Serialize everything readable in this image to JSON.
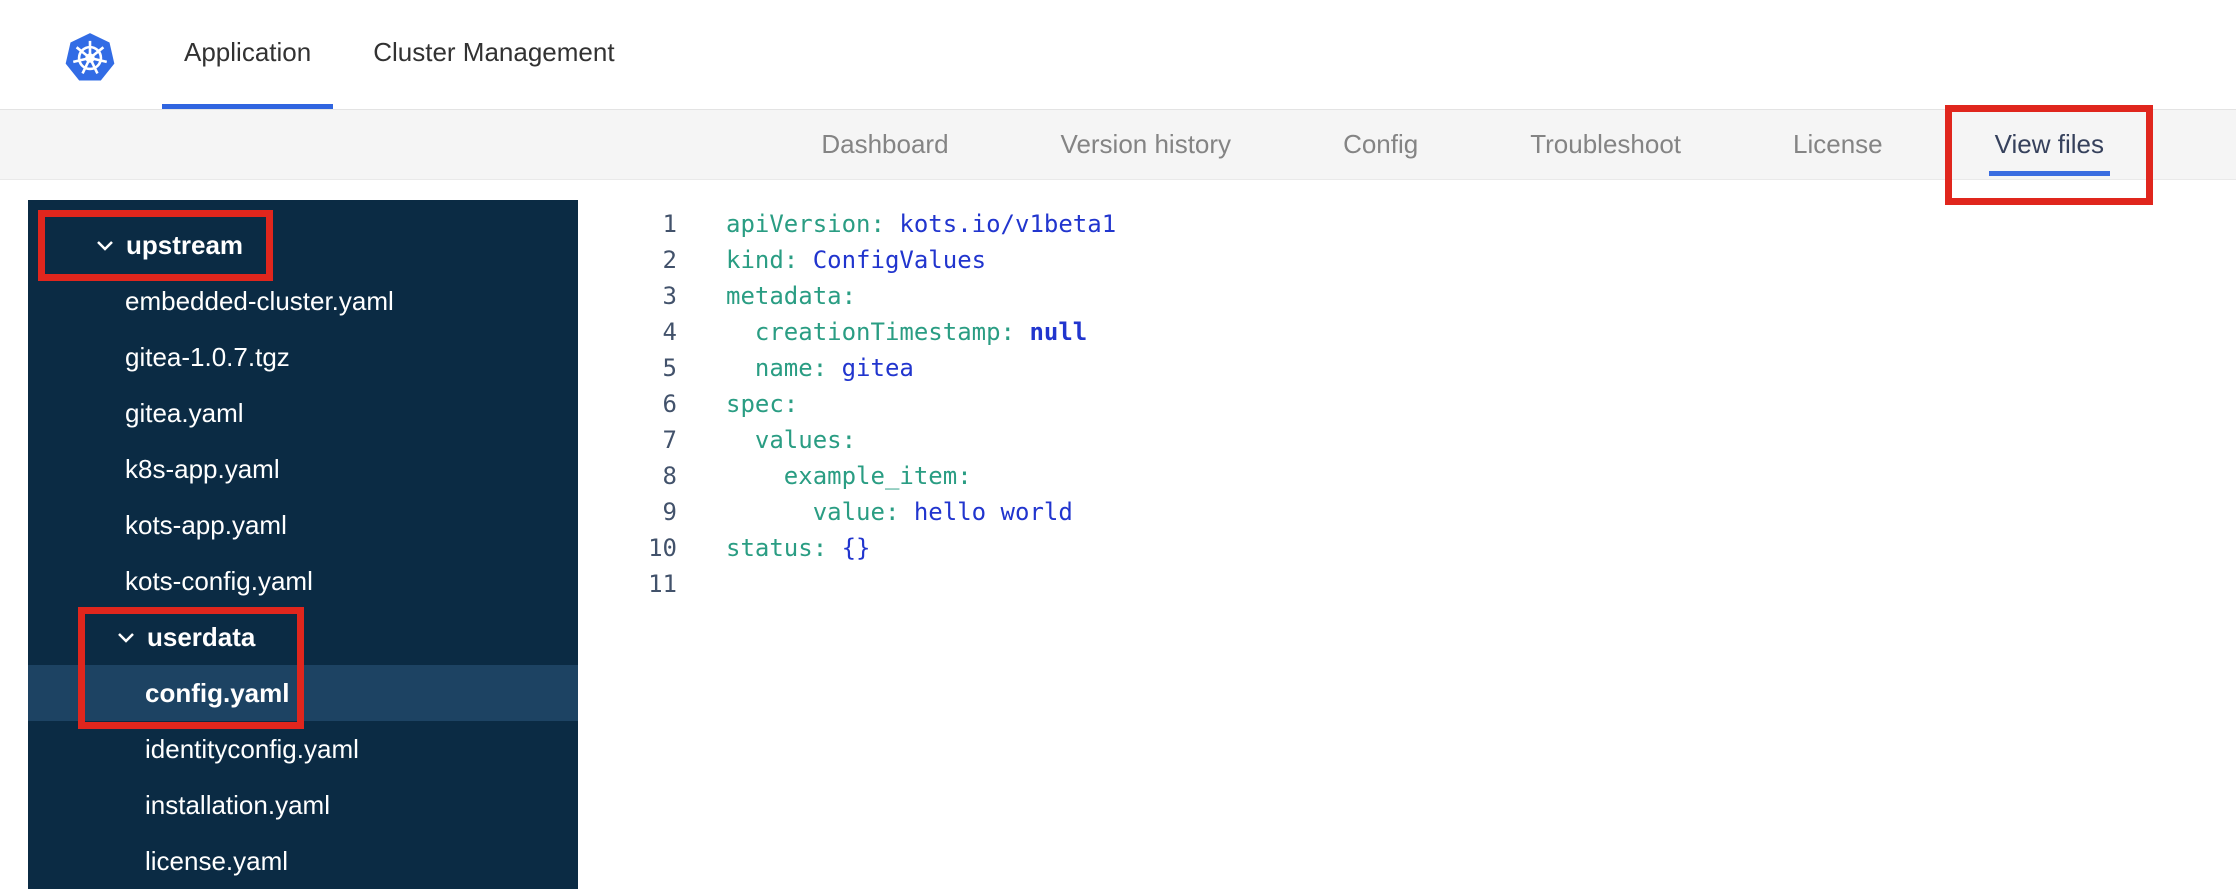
{
  "header": {
    "tabs": [
      {
        "label": "Application",
        "active": true
      },
      {
        "label": "Cluster Management",
        "active": false
      }
    ]
  },
  "subnav": {
    "items": [
      {
        "label": "Dashboard",
        "active": false
      },
      {
        "label": "Version history",
        "active": false
      },
      {
        "label": "Config",
        "active": false
      },
      {
        "label": "Troubleshoot",
        "active": false
      },
      {
        "label": "License",
        "active": false
      },
      {
        "label": "View files",
        "active": true,
        "annotated": true
      }
    ]
  },
  "file_tree": {
    "items": [
      {
        "type": "folder",
        "label": "upstream",
        "level": 0,
        "expanded": true,
        "annotated": true
      },
      {
        "type": "file",
        "label": "embedded-cluster.yaml",
        "level": 1
      },
      {
        "type": "file",
        "label": "gitea-1.0.7.tgz",
        "level": 1
      },
      {
        "type": "file",
        "label": "gitea.yaml",
        "level": 1
      },
      {
        "type": "file",
        "label": "k8s-app.yaml",
        "level": 1
      },
      {
        "type": "file",
        "label": "kots-app.yaml",
        "level": 1
      },
      {
        "type": "file",
        "label": "kots-config.yaml",
        "level": 1
      },
      {
        "type": "folder",
        "label": "userdata",
        "level": 1,
        "expanded": true,
        "annotated": true
      },
      {
        "type": "file",
        "label": "config.yaml",
        "level": 2,
        "selected": true,
        "annotated": true
      },
      {
        "type": "file",
        "label": "identityconfig.yaml",
        "level": 2
      },
      {
        "type": "file",
        "label": "installation.yaml",
        "level": 2
      },
      {
        "type": "file",
        "label": "license.yaml",
        "level": 2
      }
    ]
  },
  "editor": {
    "language": "yaml",
    "lines": [
      {
        "num": "1",
        "tokens": [
          [
            "key",
            "apiVersion:"
          ],
          [
            "plain",
            " "
          ],
          [
            "value",
            "kots.io/v1beta1"
          ]
        ]
      },
      {
        "num": "2",
        "tokens": [
          [
            "key",
            "kind:"
          ],
          [
            "plain",
            " "
          ],
          [
            "value",
            "ConfigValues"
          ]
        ]
      },
      {
        "num": "3",
        "tokens": [
          [
            "key",
            "metadata:"
          ]
        ]
      },
      {
        "num": "4",
        "tokens": [
          [
            "plain",
            "  "
          ],
          [
            "key",
            "creationTimestamp:"
          ],
          [
            "plain",
            " "
          ],
          [
            "value-bold",
            "null"
          ]
        ]
      },
      {
        "num": "5",
        "tokens": [
          [
            "plain",
            "  "
          ],
          [
            "key",
            "name:"
          ],
          [
            "plain",
            " "
          ],
          [
            "value",
            "gitea"
          ]
        ]
      },
      {
        "num": "6",
        "tokens": [
          [
            "key",
            "spec:"
          ]
        ]
      },
      {
        "num": "7",
        "tokens": [
          [
            "plain",
            "  "
          ],
          [
            "key",
            "values:"
          ]
        ]
      },
      {
        "num": "8",
        "tokens": [
          [
            "plain",
            "    "
          ],
          [
            "key",
            "example_item:"
          ]
        ]
      },
      {
        "num": "9",
        "tokens": [
          [
            "plain",
            "      "
          ],
          [
            "key",
            "value:"
          ],
          [
            "plain",
            " "
          ],
          [
            "value",
            "hello world"
          ]
        ]
      },
      {
        "num": "10",
        "tokens": [
          [
            "key",
            "status:"
          ],
          [
            "plain",
            " "
          ],
          [
            "value",
            "{}"
          ]
        ]
      },
      {
        "num": "11",
        "tokens": []
      }
    ]
  },
  "colors": {
    "accent_blue": "#3065e0",
    "annotation_red": "#e0261d",
    "sidebar_bg": "#0b2b44",
    "sidebar_selected_bg": "#1d4363",
    "code_key": "#2a9d83",
    "code_value": "#2135ce"
  },
  "icons": {
    "logo": "kubernetes-logo-icon",
    "folder_chevron": "chevron-down-icon"
  }
}
